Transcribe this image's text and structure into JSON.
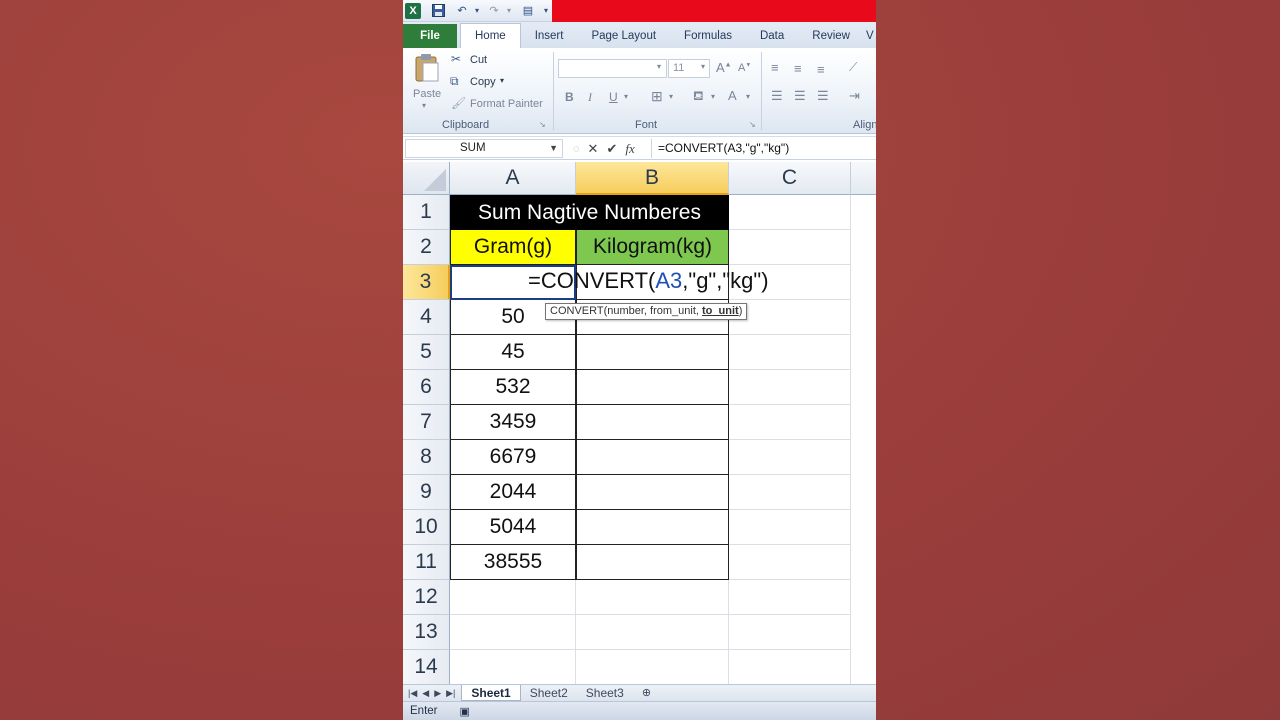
{
  "qat": {
    "app_icon": "X",
    "save_icon": "save-icon",
    "undo_icon": "undo-icon",
    "redo_icon": "redo-icon"
  },
  "tabs": [
    "File",
    "Home",
    "Insert",
    "Page Layout",
    "Formulas",
    "Data",
    "Review",
    "V"
  ],
  "ribbon": {
    "clipboard": {
      "paste": "Paste",
      "cut": "Cut",
      "copy": "Copy",
      "format_painter": "Format Painter",
      "label": "Clipboard"
    },
    "font": {
      "font_name": "",
      "font_size": "11",
      "bold": "B",
      "italic": "I",
      "underline": "U",
      "label": "Font"
    },
    "alignment": {
      "label": "Align"
    }
  },
  "formula_bar": {
    "name_box": "SUM",
    "fx": "fx",
    "formula": "=CONVERT(A3,\"g\",\"kg\")"
  },
  "columns": [
    "A",
    "B",
    "C"
  ],
  "rows": [
    "1",
    "2",
    "3",
    "4",
    "5",
    "6",
    "7",
    "8",
    "9",
    "10",
    "11",
    "12",
    "13",
    "14"
  ],
  "cells": {
    "title": "Sum Nagtive Numberes",
    "header_a": "Gram(g)",
    "header_b": "Kilogram(kg)",
    "values_a": [
      "50",
      "45",
      "532",
      "3459",
      "6679",
      "2044",
      "5044",
      "38555"
    ]
  },
  "editor": {
    "func": "=CONVERT(",
    "ref": "A3",
    "rest": ",\"g\",\"kg\")"
  },
  "tooltip": {
    "text": "CONVERT(number, from_unit, ",
    "bold": "to_unit",
    "close": ")"
  },
  "sheets": [
    "Sheet1",
    "Sheet2",
    "Sheet3"
  ],
  "status": {
    "mode": "Enter"
  },
  "colors": {
    "background": "#9c3f3c",
    "title_bg": "#000000",
    "yellow": "#ffff00",
    "green": "#7ec850",
    "accent_red": "#e8091b",
    "file_tab": "#2f7d3a"
  }
}
